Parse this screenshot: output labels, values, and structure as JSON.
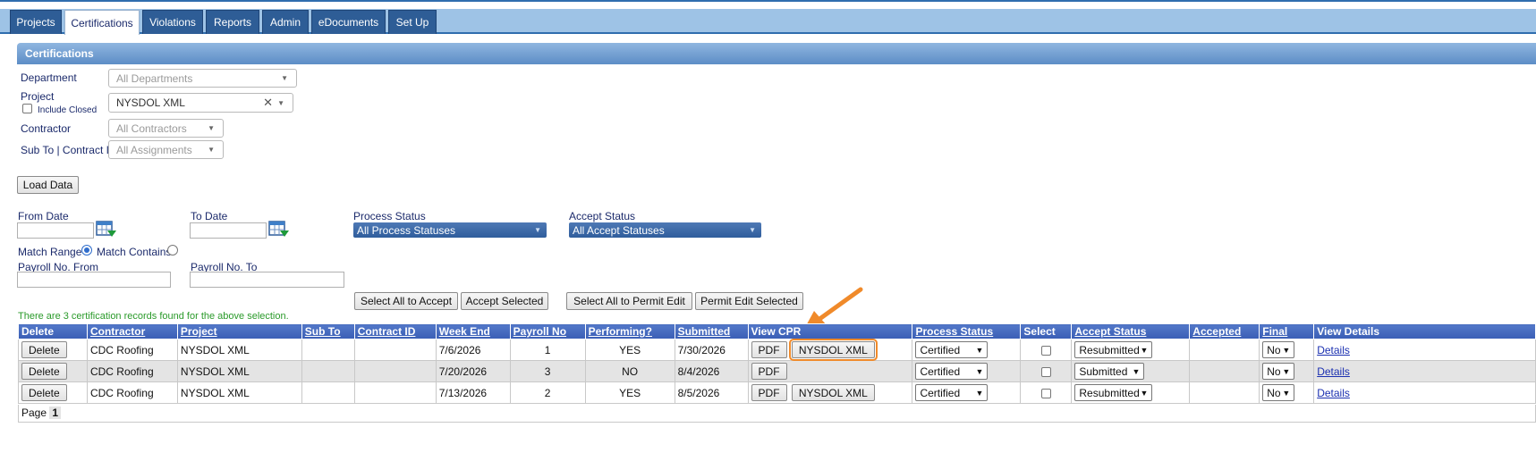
{
  "tabs": [
    {
      "label": "Projects"
    },
    {
      "label": "Certifications"
    },
    {
      "label": "Violations"
    },
    {
      "label": "Reports"
    },
    {
      "label": "Admin"
    },
    {
      "label": "eDocuments"
    },
    {
      "label": "Set Up"
    }
  ],
  "section_title": "Certifications",
  "filters": {
    "department_label": "Department",
    "department_value": "All Departments",
    "project_label": "Project",
    "include_closed_label": "Include Closed",
    "project_value": "NYSDOL XML",
    "contractor_label": "Contractor",
    "contractor_value": "All Contractors",
    "subto_label": "Sub To | Contract ID",
    "subto_value": "All Assignments",
    "load_data_label": "Load Data",
    "from_date_label": "From Date",
    "to_date_label": "To Date",
    "process_status_label": "Process Status",
    "process_status_value": "All Process Statuses",
    "accept_status_label": "Accept Status",
    "accept_status_value": "All Accept Statuses",
    "match_range_label": "Match Range",
    "match_contains_label": "Match Contains",
    "payroll_from_label": "Payroll No. From",
    "payroll_to_label": "Payroll No. To"
  },
  "actions": {
    "select_all_accept": "Select All to Accept",
    "accept_selected": "Accept Selected",
    "select_all_permit": "Select All to Permit Edit",
    "permit_selected": "Permit Edit Selected"
  },
  "result_message": "There are 3 certification records found for the above selection.",
  "columns": [
    "Delete",
    "Contractor",
    "Project",
    "Sub To",
    "Contract ID",
    "Week End",
    "Payroll No",
    "Performing?",
    "Submitted",
    "View CPR",
    "Process Status",
    "Select",
    "Accept Status",
    "Accepted",
    "Final",
    "View Details"
  ],
  "rows": [
    {
      "delete": "Delete",
      "contractor": "CDC Roofing",
      "project": "NYSDOL XML",
      "sub_to": "",
      "contract_id": "",
      "week_end": "7/6/2026",
      "payroll_no": "1",
      "performing": "YES",
      "submitted": "7/30/2026",
      "pdf": "PDF",
      "xml": "NYSDOL XML",
      "process_status": "Certified",
      "accept_status": "Resubmitted",
      "accepted": "",
      "final": "No",
      "details": "Details"
    },
    {
      "delete": "Delete",
      "contractor": "CDC Roofing",
      "project": "NYSDOL XML",
      "sub_to": "",
      "contract_id": "",
      "week_end": "7/20/2026",
      "payroll_no": "3",
      "performing": "NO",
      "submitted": "8/4/2026",
      "pdf": "PDF",
      "xml": "",
      "process_status": "Certified",
      "accept_status": "Submitted",
      "accepted": "",
      "final": "No",
      "details": "Details"
    },
    {
      "delete": "Delete",
      "contractor": "CDC Roofing",
      "project": "NYSDOL XML",
      "sub_to": "",
      "contract_id": "",
      "week_end": "7/13/2026",
      "payroll_no": "2",
      "performing": "YES",
      "submitted": "8/5/2026",
      "pdf": "PDF",
      "xml": "NYSDOL XML",
      "process_status": "Certified",
      "accept_status": "Resubmitted",
      "accepted": "",
      "final": "No",
      "details": "Details"
    }
  ],
  "pager": {
    "label": "Page",
    "current": "1"
  },
  "colors": {
    "tab": "#2e5d96",
    "header": "#3a5eb5",
    "accent_arrow": "#f08a2a",
    "message": "#2a9a2a"
  }
}
